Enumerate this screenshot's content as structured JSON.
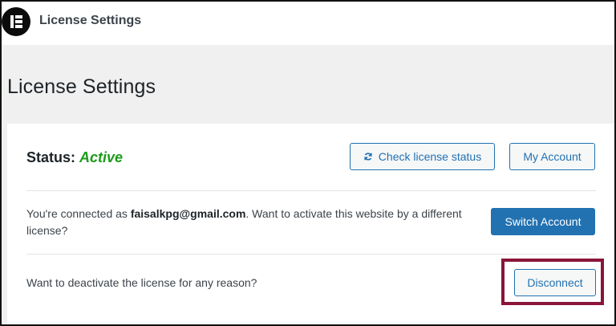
{
  "header": {
    "title": "License Settings",
    "logo_icon": "elementor-logo-icon"
  },
  "page": {
    "title": "License Settings"
  },
  "status": {
    "label": "Status:",
    "value": "Active",
    "value_color": "#1a9b1a"
  },
  "buttons": {
    "check_license": "Check license status",
    "my_account": "My Account",
    "switch_account": "Switch Account",
    "disconnect": "Disconnect"
  },
  "connection": {
    "prefix": "You're connected as ",
    "email": "faisalkpg@gmail.com",
    "suffix": ". Want to activate this website by a different license?"
  },
  "deactivate": {
    "text": "Want to deactivate the license for any reason?"
  },
  "colors": {
    "accent": "#2271b1",
    "highlight": "#8a1538"
  }
}
